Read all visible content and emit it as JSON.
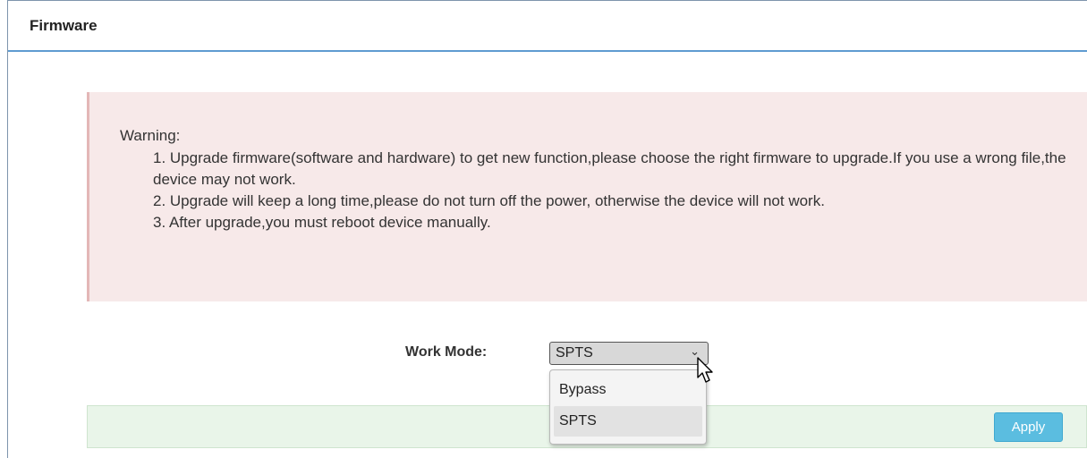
{
  "panel": {
    "title": "Firmware"
  },
  "warning": {
    "label": "Warning:",
    "items": [
      "1. Upgrade firmware(software and hardware) to get new function,please choose the right firmware to upgrade.If you use a wrong file,the device may not work.",
      "2. Upgrade will keep a long time,please do not turn off the power, otherwise the device will not work.",
      "3. After upgrade,you must reboot device manually."
    ]
  },
  "work_mode": {
    "label": "Work Mode:",
    "selected": "SPTS",
    "options": [
      "Bypass",
      "SPTS"
    ]
  },
  "actions": {
    "apply_label": "Apply"
  },
  "icons": {
    "dropdown_chevron": "chevron-down-icon",
    "cursor": "mouse-pointer-icon"
  }
}
